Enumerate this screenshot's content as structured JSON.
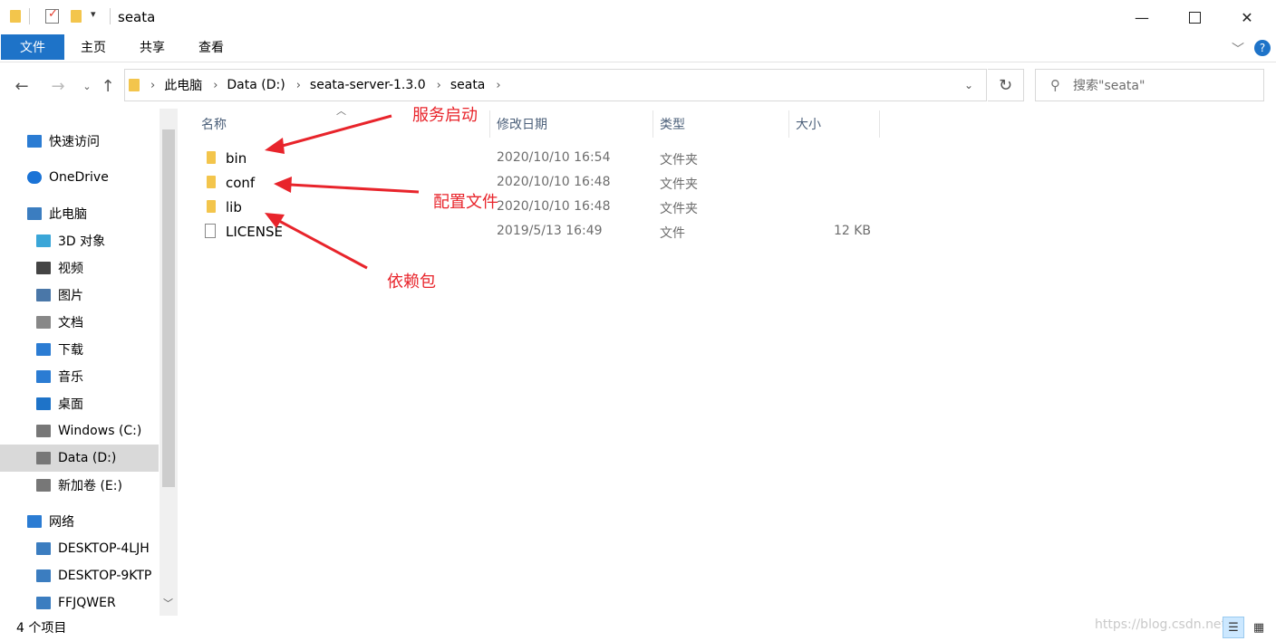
{
  "window": {
    "title": "seata"
  },
  "ribbon": {
    "tabs": [
      "文件",
      "主页",
      "共享",
      "查看"
    ]
  },
  "address": {
    "breadcrumbs": [
      "此电脑",
      "Data (D:)",
      "seata-server-1.3.0",
      "seata"
    ],
    "search_placeholder": "搜索\"seata\""
  },
  "sidebar": {
    "items": [
      {
        "label": "快速访问",
        "icon": "star-icon"
      },
      {
        "label": "OneDrive",
        "icon": "cloud-icon"
      },
      {
        "label": "此电脑",
        "icon": "computer-icon"
      },
      {
        "label": "3D 对象",
        "icon": "cube-icon"
      },
      {
        "label": "视频",
        "icon": "film-icon"
      },
      {
        "label": "图片",
        "icon": "picture-icon"
      },
      {
        "label": "文档",
        "icon": "document-icon"
      },
      {
        "label": "下载",
        "icon": "download-icon"
      },
      {
        "label": "音乐",
        "icon": "music-icon"
      },
      {
        "label": "桌面",
        "icon": "desktop-icon"
      },
      {
        "label": "Windows (C:)",
        "icon": "drive-icon"
      },
      {
        "label": "Data (D:)",
        "icon": "drive-icon"
      },
      {
        "label": "新加卷 (E:)",
        "icon": "drive-icon"
      },
      {
        "label": "网络",
        "icon": "network-icon"
      },
      {
        "label": "DESKTOP-4LJH",
        "icon": "network-computer-icon"
      },
      {
        "label": "DESKTOP-9KTP",
        "icon": "network-computer-icon"
      },
      {
        "label": "FFJQWER",
        "icon": "network-computer-icon"
      }
    ],
    "selected": "Data (D:)"
  },
  "columns": [
    "名称",
    "修改日期",
    "类型",
    "大小"
  ],
  "files": [
    {
      "name": "bin",
      "date": "2020/10/10 16:54",
      "type": "文件夹",
      "size": "",
      "icon": "folder-icon"
    },
    {
      "name": "conf",
      "date": "2020/10/10 16:48",
      "type": "文件夹",
      "size": "",
      "icon": "folder-icon"
    },
    {
      "name": "lib",
      "date": "2020/10/10 16:48",
      "type": "文件夹",
      "size": "",
      "icon": "folder-icon"
    },
    {
      "name": "LICENSE",
      "date": "2019/5/13 16:49",
      "type": "文件",
      "size": "12 KB",
      "icon": "file-icon"
    }
  ],
  "annotations": [
    "服务启动",
    "配置文件",
    "依赖包"
  ],
  "status": {
    "count_text": "4 个项目"
  },
  "watermark": "https://blog.csdn.net/..."
}
